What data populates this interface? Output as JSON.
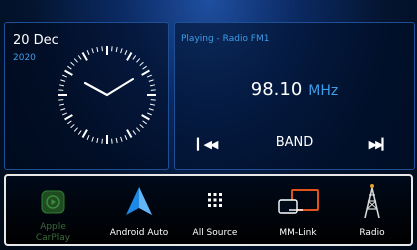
{
  "clock": {
    "date": "20 Dec",
    "year": "2020"
  },
  "radio": {
    "status": "Playing - Radio FM1",
    "frequency": "98.10",
    "unit": "MHz",
    "band_label": "BAND",
    "prev_icon": "skip-previous-icon",
    "next_icon": "skip-next-icon"
  },
  "sources": [
    {
      "label_line1": "Apple",
      "label_line2": "CarPlay",
      "icon": "apple-carplay-icon"
    },
    {
      "label": "Android Auto",
      "icon": "android-auto-icon"
    },
    {
      "label": "All Source",
      "icon": "grid-icon"
    },
    {
      "label": "MM-Link",
      "icon": "phone-screen-link-icon"
    },
    {
      "label": "Radio",
      "icon": "radio-tower-icon"
    }
  ],
  "colors": {
    "accent_blue": "#3d9de8",
    "panel_border": "#1e4f94",
    "mmlink_orange": "#e0541c",
    "carplay_green": "#2e7d32"
  }
}
